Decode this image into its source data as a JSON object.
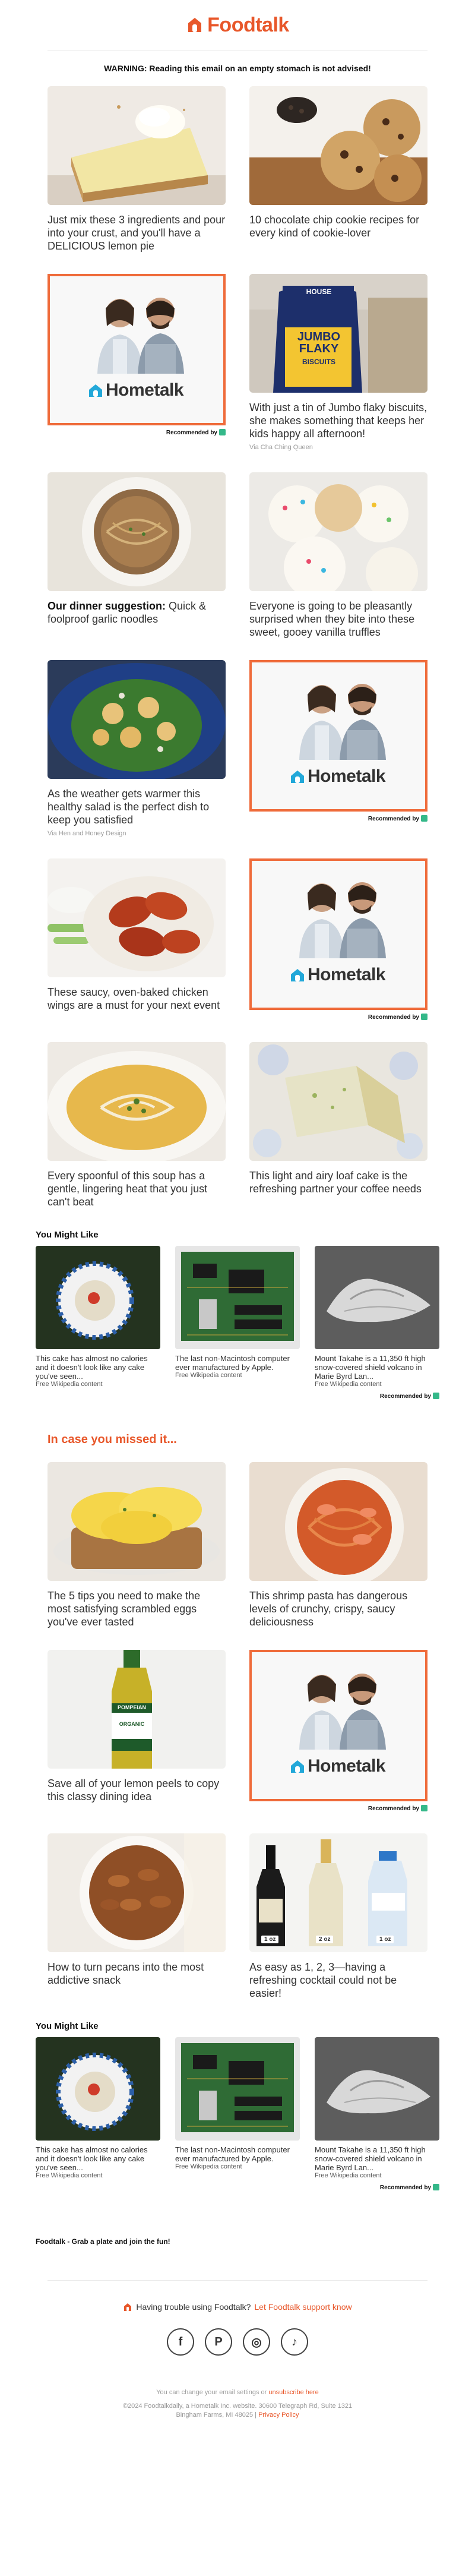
{
  "brand": {
    "name": "Foodtalk",
    "accent": "#e8572a"
  },
  "warning": "WARNING: Reading this email on an empty stomach is not advised!",
  "ad": {
    "brand": "Hometalk",
    "recommended_label": "Recommended by",
    "border_color": "#ef6b3a"
  },
  "rows1": [
    {
      "left": {
        "title": "Just mix these 3 ingredients and pour into your crust, and you'll have a DELICIOUS lemon pie",
        "image": "lemon-pie"
      },
      "right": {
        "title": "10 chocolate chip cookie recipes for every kind of cookie-lover",
        "image": "cookies"
      }
    },
    {
      "right": {
        "title": "With just a tin of Jumbo flaky biscuits, she makes something that keeps her kids happy all afternoon!",
        "via": "Via Cha Ching Queen",
        "image": "biscuits"
      }
    },
    {
      "left": {
        "title_bold": "Our dinner suggestion:",
        "title": " Quick & foolproof garlic noodles",
        "image": "garlic-noodles"
      },
      "right": {
        "title": "Everyone is going to be pleasantly surprised when they bite into these sweet, gooey vanilla truffles",
        "image": "truffles"
      }
    },
    {
      "left": {
        "title": "As the weather gets warmer this healthy salad is the perfect dish to keep you satisfied",
        "via": "Via Hen and Honey Design",
        "image": "salad"
      }
    },
    {
      "left": {
        "title": "These saucy, oven-baked chicken wings are a must for your next event",
        "image": "wings"
      }
    },
    {
      "left": {
        "title": "Every spoonful of this soup has a gentle, lingering heat that you just can't beat",
        "image": "soup"
      },
      "right": {
        "title": "This light and airy loaf cake is the refreshing partner your coffee needs",
        "image": "loaf-cake"
      }
    }
  ],
  "you_might_like": {
    "title": "You Might Like",
    "items": [
      {
        "text": "This cake has almost no calories and it doesn't look like any cake you've seen...",
        "source": "Free Wikipedia content",
        "image": "plate"
      },
      {
        "text": "The last non-Macintosh computer ever manufactured by Apple.",
        "source": "Free Wikipedia content",
        "image": "circuit-board"
      },
      {
        "text": "Mount Takahe is a 11,350 ft high snow-covered shield volcano in Marie Byrd Lan...",
        "source": "Free Wikipedia content",
        "image": "volcano"
      }
    ]
  },
  "missed_heading": "In case you missed it...",
  "rows2": [
    {
      "left": {
        "title": "The 5 tips you need to make the most satisfying scrambled eggs you've ever tasted",
        "image": "eggs"
      },
      "right": {
        "title": "This shrimp pasta has dangerous levels of crunchy, crispy, saucy deliciousness",
        "image": "shrimp-pasta"
      }
    },
    {
      "left": {
        "title": "Save all of your lemon peels to copy this classy dining idea",
        "image": "olive-oil",
        "bottle_label": "POMPEIAN",
        "bottle_sub": "ORGANIC"
      }
    },
    {
      "left": {
        "title": "How to turn pecans into the most addictive snack",
        "image": "pecans"
      },
      "right": {
        "title": "As easy as 1, 2, 3—having a refreshing cocktail could not be easier!",
        "image": "bottles",
        "tags": [
          "1 oz",
          "2 oz",
          "1 oz"
        ]
      }
    }
  ],
  "signoff": "Foodtalk - Grab a plate and join the fun!",
  "footer": {
    "trouble_text": "Having trouble using Foodtalk?",
    "trouble_link": "Let Foodtalk support know",
    "social": [
      "f",
      "P",
      "◎",
      "♪"
    ],
    "settings_text": "You can change your email settings or",
    "unsubscribe": "unsubscribe here",
    "copyright": "©2024 Foodtalkdaily, a Hometalk Inc. website. 30600 Telegraph Rd, Suite 1321",
    "address2": "Bingham Farms, MI 48025",
    "privacy": "Privacy Policy"
  }
}
